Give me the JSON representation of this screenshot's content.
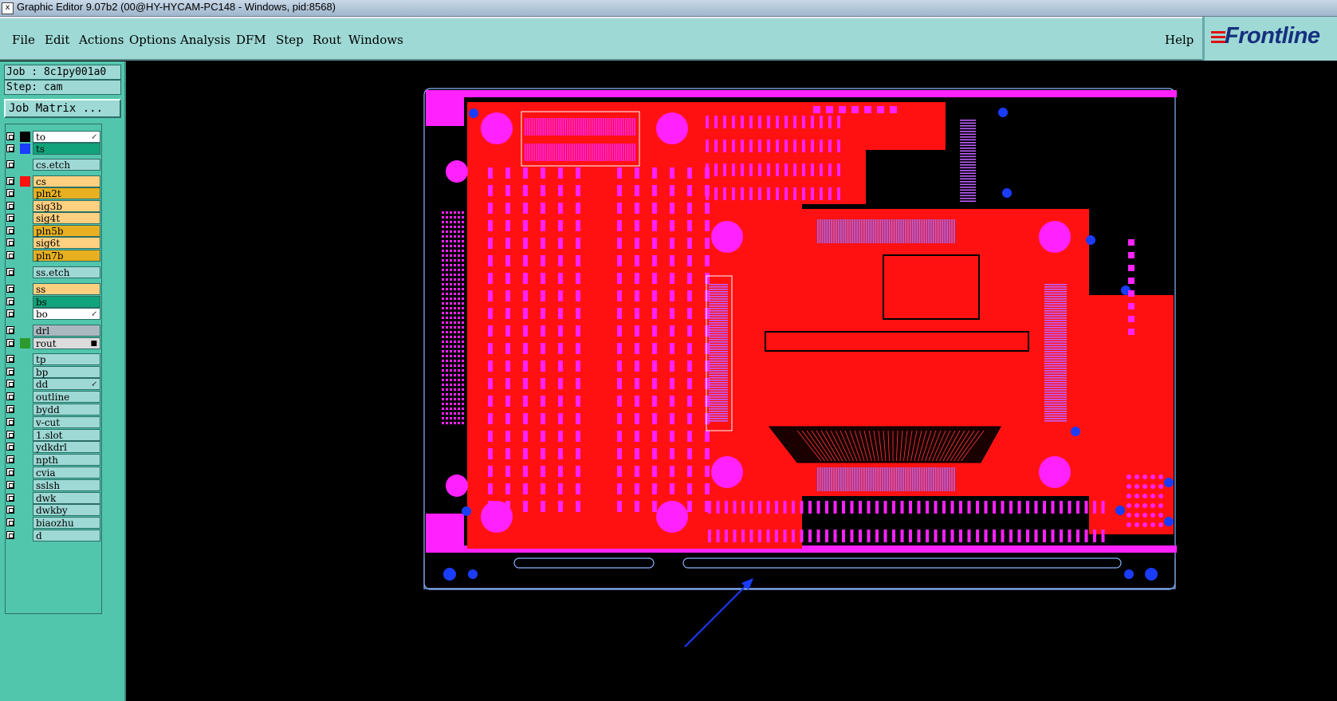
{
  "window": {
    "title": "Graphic Editor 9.07b2 (00@HY-HYCAM-PC148 - Windows, pid:8568)",
    "app_icon_glyph": "x"
  },
  "menubar": {
    "items": [
      "File",
      "Edit",
      "Actions",
      "Options",
      "Analysis",
      "DFM",
      "Step",
      "Rout",
      "Windows"
    ],
    "help": "Help"
  },
  "logo": {
    "text": "Frontline"
  },
  "sidebar": {
    "job": "Job : 8c1py001a0",
    "step": "Step: cam",
    "job_matrix_button": "Job Matrix ...",
    "layers": [
      {
        "name": "to",
        "color": "#ffffff",
        "swatch": "#000000",
        "marker": "↙"
      },
      {
        "name": "ts",
        "color": "#11a37a",
        "swatch": "#1a3cff",
        "marker": ""
      },
      {
        "name": "cs.etch",
        "color": "#9ed9d5",
        "swatch": "",
        "marker": ""
      },
      {
        "name": "cs",
        "color": "#ffd080",
        "swatch": "#ff1111",
        "marker": ""
      },
      {
        "name": "pln2t",
        "color": "#e6b020",
        "swatch": "",
        "marker": ""
      },
      {
        "name": "sig3b",
        "color": "#ffd080",
        "swatch": "",
        "marker": ""
      },
      {
        "name": "sig4t",
        "color": "#ffd080",
        "swatch": "",
        "marker": ""
      },
      {
        "name": "pln5b",
        "color": "#e6b020",
        "swatch": "",
        "marker": ""
      },
      {
        "name": "sig6t",
        "color": "#ffd080",
        "swatch": "",
        "marker": ""
      },
      {
        "name": "pln7b",
        "color": "#e6b020",
        "swatch": "",
        "marker": ""
      },
      {
        "name": "ss.etch",
        "color": "#9ed9d5",
        "swatch": "",
        "marker": ""
      },
      {
        "name": "ss",
        "color": "#ffd080",
        "swatch": "",
        "marker": ""
      },
      {
        "name": "bs",
        "color": "#11a37a",
        "swatch": "",
        "marker": ""
      },
      {
        "name": "bo",
        "color": "#ffffff",
        "swatch": "",
        "marker": "↙"
      },
      {
        "name": "drl",
        "color": "#aab9c0",
        "swatch": "",
        "marker": ""
      },
      {
        "name": "rout",
        "color": "#dcdcdc",
        "swatch": "#2e9a2e",
        "marker": "■"
      },
      {
        "name": "tp",
        "color": "#9ed9d5",
        "swatch": "",
        "marker": ""
      },
      {
        "name": "bp",
        "color": "#9ed9d5",
        "swatch": "",
        "marker": ""
      },
      {
        "name": "dd",
        "color": "#9ed9d5",
        "swatch": "",
        "marker": "↙"
      },
      {
        "name": "outline",
        "color": "#9ed9d5",
        "swatch": "",
        "marker": ""
      },
      {
        "name": "bydd",
        "color": "#9ed9d5",
        "swatch": "",
        "marker": ""
      },
      {
        "name": "v-cut",
        "color": "#9ed9d5",
        "swatch": "",
        "marker": ""
      },
      {
        "name": "1.slot",
        "color": "#9ed9d5",
        "swatch": "",
        "marker": ""
      },
      {
        "name": "ydkdrl",
        "color": "#9ed9d5",
        "swatch": "",
        "marker": ""
      },
      {
        "name": "npth",
        "color": "#9ed9d5",
        "swatch": "",
        "marker": ""
      },
      {
        "name": "cvia",
        "color": "#9ed9d5",
        "swatch": "",
        "marker": ""
      },
      {
        "name": "sslsh",
        "color": "#9ed9d5",
        "swatch": "",
        "marker": ""
      },
      {
        "name": "dwk",
        "color": "#9ed9d5",
        "swatch": "",
        "marker": ""
      },
      {
        "name": "dwkby",
        "color": "#9ed9d5",
        "swatch": "",
        "marker": ""
      },
      {
        "name": "biaozhu",
        "color": "#9ed9d5",
        "swatch": "",
        "marker": ""
      },
      {
        "name": "d",
        "color": "#9ed9d5",
        "swatch": "",
        "marker": ""
      }
    ]
  },
  "canvas": {
    "background": "#000000",
    "board_copper_color": "#ff1111",
    "pad_color": "#ff22ff",
    "via_color": "#1a3cff",
    "outline_color": "#8ab4ff",
    "arrow_color": "#1a3cff"
  }
}
